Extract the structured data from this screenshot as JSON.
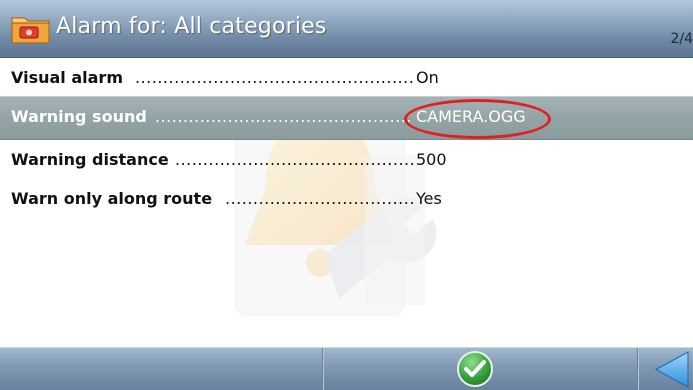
{
  "header": {
    "title": "Alarm for: All categories",
    "page_indicator": "2/4",
    "icon": "folder-icon"
  },
  "settings": [
    {
      "label": "Visual alarm",
      "value": "On",
      "selected": false
    },
    {
      "label": "Warning sound",
      "value": "CAMERA.OGG",
      "selected": true
    },
    {
      "label": "Warning distance",
      "value": "500",
      "selected": false
    },
    {
      "label": "Warn only along route",
      "value": "Yes",
      "selected": false
    }
  ],
  "bottom_bar": {
    "ok_icon": "checkmark-icon",
    "back_icon": "back-arrow-icon"
  },
  "colors": {
    "header": "#7f98b3",
    "selected_row": "#94a4a6",
    "highlight": "#e02020",
    "ok_button": "#3aa540",
    "back_arrow": "#4aa8e8"
  }
}
